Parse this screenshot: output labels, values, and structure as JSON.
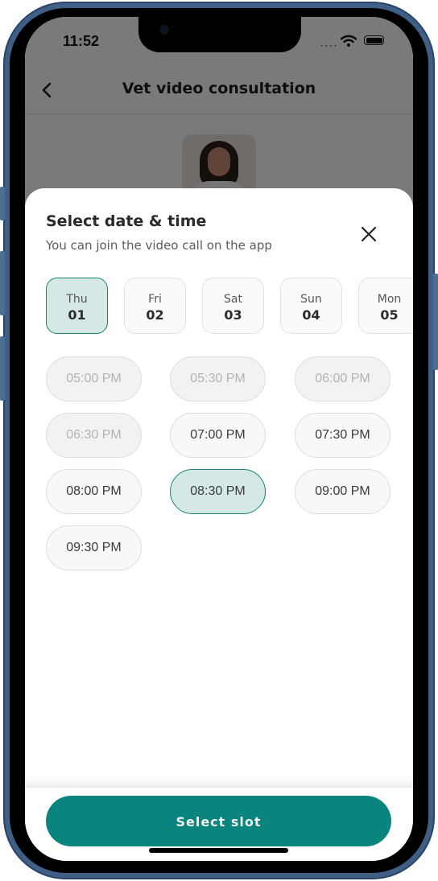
{
  "status_bar": {
    "time": "11:52",
    "signal_icon": "signal-dots-icon",
    "wifi_icon": "wifi-icon",
    "battery_icon": "battery-icon"
  },
  "header": {
    "back_icon": "chevron-left-icon",
    "title": "Vet video consultation"
  },
  "doctor": {
    "photo": "doctor-avatar"
  },
  "sheet": {
    "title": "Select date & time",
    "subtitle": "You can join the video call on the app",
    "close_icon": "close-icon",
    "dates": [
      {
        "day": "Thu",
        "date": "01",
        "selected": true
      },
      {
        "day": "Fri",
        "date": "02",
        "selected": false
      },
      {
        "day": "Sat",
        "date": "03",
        "selected": false
      },
      {
        "day": "Sun",
        "date": "04",
        "selected": false
      },
      {
        "day": "Mon",
        "date": "05",
        "selected": false
      }
    ],
    "slots": [
      {
        "label": "05:00 PM",
        "state": "disabled"
      },
      {
        "label": "05:30 PM",
        "state": "disabled"
      },
      {
        "label": "06:00 PM",
        "state": "disabled"
      },
      {
        "label": "06:30 PM",
        "state": "disabled"
      },
      {
        "label": "07:00 PM",
        "state": "available"
      },
      {
        "label": "07:30 PM",
        "state": "available"
      },
      {
        "label": "08:00 PM",
        "state": "available"
      },
      {
        "label": "08:30 PM",
        "state": "selected"
      },
      {
        "label": "09:00 PM",
        "state": "available"
      },
      {
        "label": "09:30 PM",
        "state": "available"
      }
    ],
    "select_button": "Select slot"
  },
  "colors": {
    "accent": "#0a857d",
    "selected_bg": "#d4e8e6",
    "selected_border": "#17857b",
    "frame": "#3f5f86"
  }
}
